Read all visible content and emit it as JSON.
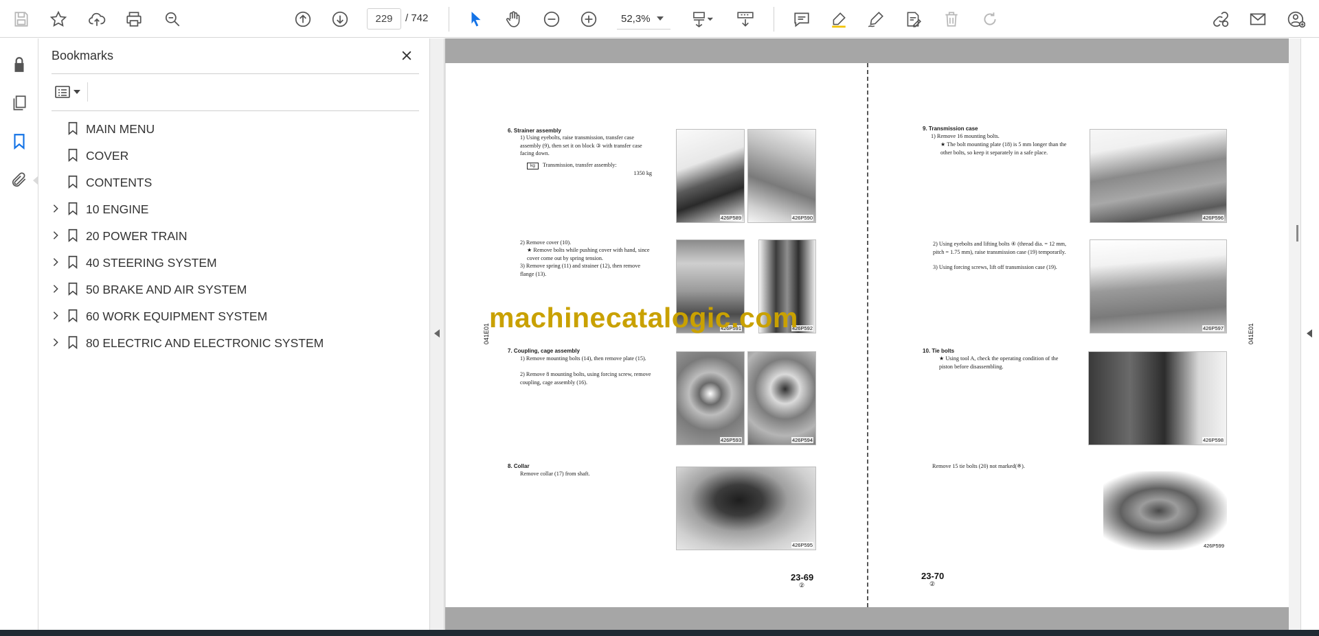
{
  "toolbar": {
    "current_page": "229",
    "total_pages": "/  742",
    "zoom": "52,3%"
  },
  "panel": {
    "title": "Bookmarks",
    "bookmarks": [
      {
        "label": "MAIN MENU",
        "expandable": false
      },
      {
        "label": "COVER",
        "expandable": false
      },
      {
        "label": "CONTENTS",
        "expandable": false
      },
      {
        "label": "10 ENGINE",
        "expandable": true
      },
      {
        "label": "20 POWER TRAIN",
        "expandable": true
      },
      {
        "label": "40 STEERING SYSTEM",
        "expandable": true
      },
      {
        "label": "50 BRAKE AND AIR SYSTEM",
        "expandable": true
      },
      {
        "label": "60 WORK EQUIPMENT SYSTEM",
        "expandable": true
      },
      {
        "label": "80 ELECTRIC AND ELECTRONIC SYSTEM",
        "expandable": true
      }
    ]
  },
  "watermark": "machinecatalogic.com",
  "left_page": {
    "side_code": "041E01",
    "s6_title": "6.   Strainer assembly",
    "s6_1": "1) Using eyebolts, raise transmission, transfer case assembly (9), then set it on block ③ with transfer case facing down.",
    "kg_label": "kg",
    "s6_weight_label": "Transmission, transfer assembly:",
    "s6_weight_value": "1350 kg",
    "s6_2": "2) Remove cover (10).",
    "s6_2a": "★ Remove bolts while pushing cover with hand, since cover come out by spring tension.",
    "s6_3": "3) Remove spring (11) and strainer (12), then remove flange (13).",
    "s7_title": "7.   Coupling, cage assembly",
    "s7_1": "1) Remove mounting bolts (14), then remove plate (15).",
    "s7_2": "2) Remove 8 mounting bolts, using forcing screw, remove coupling, cage assembly (16).",
    "s8_title": "8.   Collar",
    "s8_1": "Remove collar (17) from shaft.",
    "photos": [
      "426P589",
      "426P590",
      "426P591",
      "426P592",
      "426P593",
      "426P594",
      "426P595"
    ],
    "page_number": "23-69",
    "page_rev": "②"
  },
  "right_page": {
    "side_code": "041E01",
    "s9_title": "9.   Transmission case",
    "s9_1": "1) Remove 16 mounting bolts.",
    "s9_1a": "★ The bolt mounting plate (18) is 5 mm longer than the other bolts, so keep it separately in a safe place.",
    "s9_2": "2) Using eyebolts and lifting bolts ④ (thread dia. = 12 mm, pitch = 1.75 mm), raise transmission case (19) temporarily.",
    "s9_3": "3) Using forcing screws, lift off transmission case (19).",
    "s10_title": "10.  Tie bolts",
    "s10_1": "★ Using tool A, check the operating condition of the piston before disassembling.",
    "s10_2": "Remove 15 tie bolts (20) not marked(※).",
    "photos": [
      "426P596",
      "426P597",
      "426P598",
      "426P599"
    ],
    "page_number": "23-70",
    "page_rev": "②"
  },
  "colors": {
    "accent": "#1473e6",
    "watermark": "#c9a100"
  }
}
